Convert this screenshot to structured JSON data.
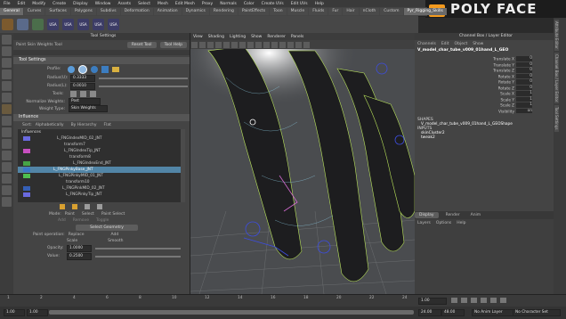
{
  "logo": {
    "text": "POLY FACE"
  },
  "menubar": [
    "File",
    "Edit",
    "Modify",
    "Create",
    "Display",
    "Window",
    "Assets",
    "Select",
    "Mesh",
    "Edit Mesh",
    "Proxy",
    "Normals",
    "Color",
    "Create UVs",
    "Edit UVs",
    "Help"
  ],
  "shelf_tabs": [
    {
      "label": "General",
      "active": true
    },
    {
      "label": "Curves"
    },
    {
      "label": "Surfaces"
    },
    {
      "label": "Polygons"
    },
    {
      "label": "Subdivs"
    },
    {
      "label": "Deformation"
    },
    {
      "label": "Animation"
    },
    {
      "label": "Dynamics"
    },
    {
      "label": "Rendering"
    },
    {
      "label": "PaintEffects"
    },
    {
      "label": "Toon"
    },
    {
      "label": "Muscle"
    },
    {
      "label": "Fluids"
    },
    {
      "label": "Fur"
    },
    {
      "label": "Hair"
    },
    {
      "label": "nCloth"
    },
    {
      "label": "Custom"
    },
    {
      "label": "Pyr_Rigging_Skills",
      "active": true
    }
  ],
  "shelf_icons": [
    "USA",
    "USA",
    "USA",
    "USA",
    "USA"
  ],
  "tool_settings": {
    "panel_title": "Tool Settings",
    "tool_name": "Paint Skin Weights Tool",
    "reset_label": "Reset Tool",
    "help_label": "Tool Help",
    "brush_section": "Tool Settings",
    "profile_label": "Profile:",
    "radius_u_label": "Radius(U):",
    "radius_u_value": "0.3333",
    "radius_l_label": "Radius(L):",
    "radius_l_value": "0.0010",
    "tools_label": "Tools:",
    "normalize_label": "Normalize Weights:",
    "normalize_value": "Post",
    "weight_type_label": "Weight Type:",
    "weight_type_value": "Skin Weights",
    "influence_section": "Influence",
    "sort_label": "Sort:",
    "sort_options": [
      "Alphabetically",
      "By Hierarchy",
      "Flat"
    ],
    "influences_header": "Influences",
    "influences": [
      {
        "name": "L_FNGIndexMID_02_JNT",
        "color": "#6a6adf"
      },
      {
        "name": "transform7",
        "color": ""
      },
      {
        "name": "L_FNGIndexTip_JNT",
        "color": "#c84fc0"
      },
      {
        "name": "transform8",
        "color": ""
      },
      {
        "name": "L_FNGIndexEnd_JNT",
        "color": "#46a346"
      },
      {
        "name": "L_FNGPinkyBase_JNT",
        "color": "#3b77c9",
        "selected": true
      },
      {
        "name": "L_FNGPinkyMID_01_JNT",
        "color": "#4fbf4f"
      },
      {
        "name": "transform10",
        "color": ""
      },
      {
        "name": "L_FNGPinkMID_02_JNT",
        "color": "#355fb5"
      },
      {
        "name": "L_FNGPinkyTip_JNT",
        "color": "#6a6adf"
      }
    ],
    "mode_label": "Mode:",
    "mode_options": [
      "Paint",
      "Select",
      "Paint Select"
    ],
    "select_sub_options": [
      "Add",
      "Remove",
      "Toggle"
    ],
    "select_geometry_label": "Select Geometry",
    "paint_op_label": "Paint operation:",
    "paint_ops": [
      "Replace",
      "Add",
      "Scale",
      "Smooth"
    ],
    "opacity_label": "Opacity:",
    "opacity_value": "1.0000",
    "value_label": "Value:",
    "value_value": "0.2500"
  },
  "viewport": {
    "menu": [
      "View",
      "Shading",
      "Lighting",
      "Show",
      "Renderer",
      "Panels"
    ]
  },
  "channel_box": {
    "title": "Channel Box / Layer Editor",
    "menu": [
      "Channels",
      "Edit",
      "Object",
      "Show"
    ],
    "object_name": "V_model_char_tube_v009_01hand_L_GEO",
    "channels": [
      {
        "name": "Translate X",
        "value": "0"
      },
      {
        "name": "Translate Y",
        "value": "0"
      },
      {
        "name": "Translate Z",
        "value": "0"
      },
      {
        "name": "Rotate X",
        "value": "0"
      },
      {
        "name": "Rotate Y",
        "value": "0"
      },
      {
        "name": "Rotate Z",
        "value": "0"
      },
      {
        "name": "Scale X",
        "value": "1"
      },
      {
        "name": "Scale Y",
        "value": "1"
      },
      {
        "name": "Scale Z",
        "value": "1"
      },
      {
        "name": "Visibility",
        "value": "on"
      }
    ],
    "shapes_label": "SHAPES",
    "shape_name": "V_model_char_tube_v009_01hand_L_GEOShape",
    "inputs_label": "INPUTS",
    "inputs": [
      "skinCluster2",
      "tweak2"
    ]
  },
  "layer_editor": {
    "tabs": [
      "Display",
      "Render",
      "Anim"
    ],
    "menu": [
      "Layers",
      "Options",
      "Help"
    ]
  },
  "timeline": {
    "ticks": [
      "1",
      "2",
      "4",
      "6",
      "8",
      "10",
      "12",
      "14",
      "16",
      "18",
      "20",
      "22",
      "24"
    ],
    "current": "1.00"
  },
  "range_bar": {
    "start": "1.00",
    "inner_start": "1.00",
    "inner_end": "24.00",
    "end": "48.00",
    "anim_layer": "No Anim Layer",
    "char_set": "No Character Set"
  },
  "side_tabs": [
    "Attribute Editor",
    "Channel Box / Layer Editor",
    "Tool Settings"
  ]
}
